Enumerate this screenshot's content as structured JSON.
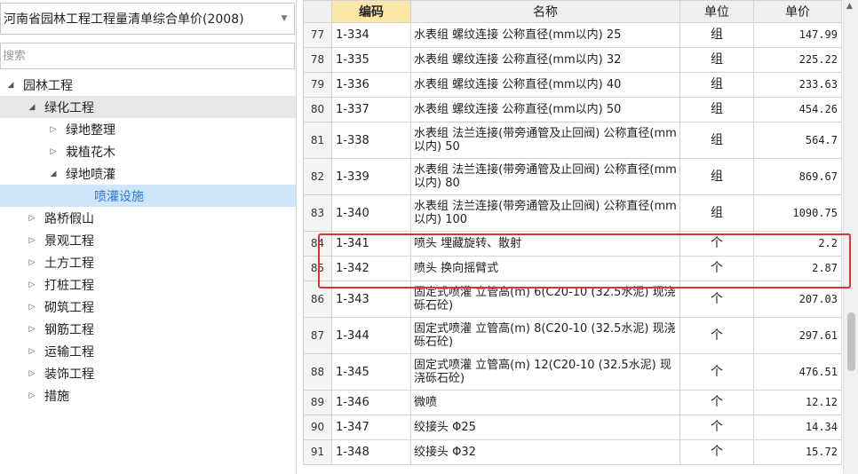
{
  "left_panel": {
    "combo_value": "河南省园林工程工程量清单综合单价(2008)",
    "search_placeholder": "搜索",
    "tree": [
      {
        "label": "园林工程",
        "level": 0,
        "expanded": true
      },
      {
        "label": "绿化工程",
        "level": 1,
        "expanded": true,
        "hover": true
      },
      {
        "label": "绿地整理",
        "level": 2,
        "expanded": false
      },
      {
        "label": "栽植花木",
        "level": 2,
        "expanded": false
      },
      {
        "label": "绿地喷灌",
        "level": 2,
        "expanded": true
      },
      {
        "label": "喷灌设施",
        "level": 3,
        "leaf": true,
        "selected": true
      },
      {
        "label": "路桥假山",
        "level": 1,
        "expanded": false
      },
      {
        "label": "景观工程",
        "level": 1,
        "expanded": false
      },
      {
        "label": "土方工程",
        "level": 1,
        "expanded": false
      },
      {
        "label": "打桩工程",
        "level": 1,
        "expanded": false
      },
      {
        "label": "砌筑工程",
        "level": 1,
        "expanded": false
      },
      {
        "label": "钢筋工程",
        "level": 1,
        "expanded": false
      },
      {
        "label": "运输工程",
        "level": 1,
        "expanded": false
      },
      {
        "label": "装饰工程",
        "level": 1,
        "expanded": false
      },
      {
        "label": "措施",
        "level": 1,
        "expanded": false
      }
    ]
  },
  "table": {
    "headers": {
      "code": "编码",
      "name": "名称",
      "unit": "单位",
      "price": "单价"
    },
    "rows": [
      {
        "idx": "77",
        "code": "1-334",
        "name": "水表组 螺纹连接 公称直径(mm以内) 25",
        "unit": "组",
        "price": "147.99"
      },
      {
        "idx": "78",
        "code": "1-335",
        "name": "水表组 螺纹连接 公称直径(mm以内) 32",
        "unit": "组",
        "price": "225.22"
      },
      {
        "idx": "79",
        "code": "1-336",
        "name": "水表组 螺纹连接 公称直径(mm以内) 40",
        "unit": "组",
        "price": "233.63"
      },
      {
        "idx": "80",
        "code": "1-337",
        "name": "水表组 螺纹连接 公称直径(mm以内) 50",
        "unit": "组",
        "price": "454.26"
      },
      {
        "idx": "81",
        "code": "1-338",
        "name": "水表组 法兰连接(带旁通管及止回阀) 公称直径(mm以内) 50",
        "unit": "组",
        "price": "564.7",
        "tall": true
      },
      {
        "idx": "82",
        "code": "1-339",
        "name": "水表组 法兰连接(带旁通管及止回阀) 公称直径(mm以内) 80",
        "unit": "组",
        "price": "869.67",
        "tall": true
      },
      {
        "idx": "83",
        "code": "1-340",
        "name": "水表组 法兰连接(带旁通管及止回阀) 公称直径(mm以内) 100",
        "unit": "组",
        "price": "1090.75",
        "tall": true
      },
      {
        "idx": "84",
        "code": "1-341",
        "name": "喷头 埋藏旋转、散射",
        "unit": "个",
        "price": "2.2"
      },
      {
        "idx": "85",
        "code": "1-342",
        "name": "喷头 换向摇臂式",
        "unit": "个",
        "price": "2.87"
      },
      {
        "idx": "86",
        "code": "1-343",
        "name": "固定式喷灌 立管高(m) 6(C20-10 (32.5水泥) 现浇砾石砼)",
        "unit": "个",
        "price": "207.03",
        "tall": true
      },
      {
        "idx": "87",
        "code": "1-344",
        "name": "固定式喷灌 立管高(m) 8(C20-10 (32.5水泥) 现浇砾石砼)",
        "unit": "个",
        "price": "297.61",
        "tall": true
      },
      {
        "idx": "88",
        "code": "1-345",
        "name": "固定式喷灌 立管高(m) 12(C20-10 (32.5水泥) 现浇砾石砼)",
        "unit": "个",
        "price": "476.51",
        "tall": true
      },
      {
        "idx": "89",
        "code": "1-346",
        "name": "微喷",
        "unit": "个",
        "price": "12.12"
      },
      {
        "idx": "90",
        "code": "1-347",
        "name": "绞接头 Φ25",
        "unit": "个",
        "price": "14.34"
      },
      {
        "idx": "91",
        "code": "1-348",
        "name": "绞接头 Φ32",
        "unit": "个",
        "price": "15.72"
      }
    ]
  },
  "colors": {
    "highlight": "#e03232",
    "selected_bg": "#cfe5fa",
    "selected_text": "#2a7bd4",
    "code_header_bg": "#fce7a9"
  }
}
